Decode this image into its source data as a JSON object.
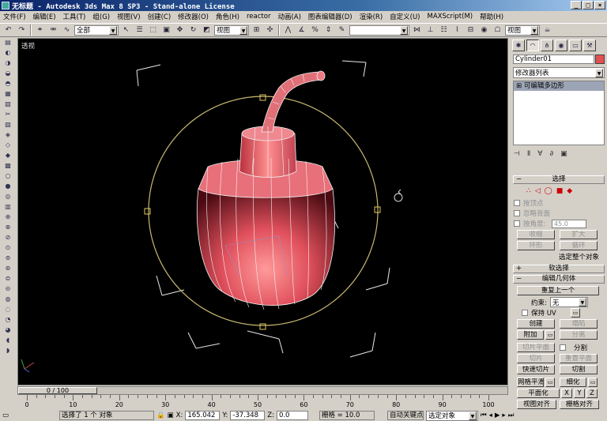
{
  "window": {
    "title": "无标题   - Autodesk 3ds Max 8 SP3   - Stand-alone License",
    "min": "_",
    "max": "□",
    "close": "×"
  },
  "menu": [
    "文件(F)",
    "编辑(E)",
    "工具(T)",
    "组(G)",
    "视图(V)",
    "创建(C)",
    "修改器(O)",
    "角色(H)",
    "reactor",
    "动画(A)",
    "图表编辑器(D)",
    "渲染(R)",
    "自定义(U)",
    "MAXScript(M)",
    "帮助(H)"
  ],
  "toolbar": {
    "selection_filter": "全部",
    "ref_coord": "视图",
    "named_selection": "",
    "viewport_combo": "视图"
  },
  "viewport": {
    "label": "透视"
  },
  "panel": {
    "object_name": "Cylinder01",
    "modifier_list": "修改器列表",
    "stack_entry": "可编辑多边形",
    "selection": {
      "title": "选择",
      "by_vertex": "按顶点",
      "ignore_backfacing": "忽略背面",
      "by_angle": "按角度:",
      "angle_value": "45.0",
      "shrink": "收缩",
      "grow": "扩大",
      "ring": "环形",
      "loop": "循环",
      "select_whole": "选定整个对象"
    },
    "soft_selection": {
      "title": "软选择"
    },
    "edit_geometry": {
      "title": "编辑几何体",
      "repeat_last": "重复上一个",
      "constraints_label": "约束:",
      "constraints_value": "无",
      "preserve_uvs": "保持 UV",
      "create": "创建",
      "collapse": "塌陷",
      "attach": "附加",
      "detach": "分离",
      "slice_plane": "切片平面",
      "split": "分割",
      "slice": "切片",
      "reset_plane": "重置平面",
      "quickslice": "快速切片",
      "cut": "切割",
      "msmooth": "网格平滑",
      "tessellate": "细化",
      "make_planar": "平面化",
      "x": "X",
      "y": "Y",
      "z": "Z",
      "view_align": "视图对齐",
      "grid_align": "栅格对齐"
    }
  },
  "timeline": {
    "slider": "0 / 100",
    "ticks": [
      "0",
      "10",
      "20",
      "30",
      "40",
      "50",
      "60",
      "70",
      "80",
      "90",
      "100"
    ]
  },
  "status": {
    "selected": "选择了 1 个 对象",
    "x_label": "X:",
    "x_value": "165.042",
    "y_label": "Y:",
    "y_value": "-37.348",
    "z_label": "Z:",
    "z_value": "0.0",
    "grid": "栅格 = 10.0",
    "autokey": "自动关键点",
    "selected_combo": "选定对象"
  }
}
